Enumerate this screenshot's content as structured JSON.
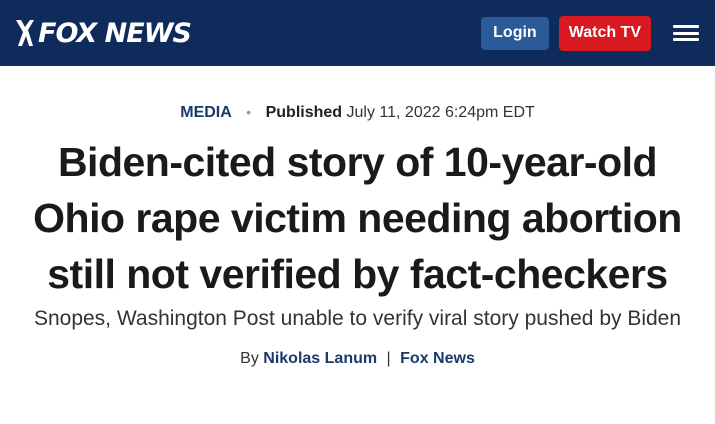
{
  "header": {
    "logo_text": "FOX NEWS",
    "login_label": "Login",
    "watch_label": "Watch TV",
    "colors": {
      "bar": "#0f2b5b",
      "login": "#2a5a97",
      "watch": "#d81921"
    }
  },
  "article": {
    "category": "MEDIA",
    "published_label": "Published",
    "published_date": "July 11, 2022 6:24pm EDT",
    "headline": "Biden-cited story of 10-year-old Ohio rape victim needing abortion still not verified by fact-checkers",
    "subheadline": "Snopes, Washington Post unable to verify viral story pushed by Biden",
    "byline_prefix": "By",
    "author": "Nikolas Lanum",
    "byline_separator": "|",
    "outlet": "Fox News"
  },
  "icons": {
    "menu": "hamburger-menu-icon",
    "logo_mark": "fox-logo-mark-icon"
  }
}
